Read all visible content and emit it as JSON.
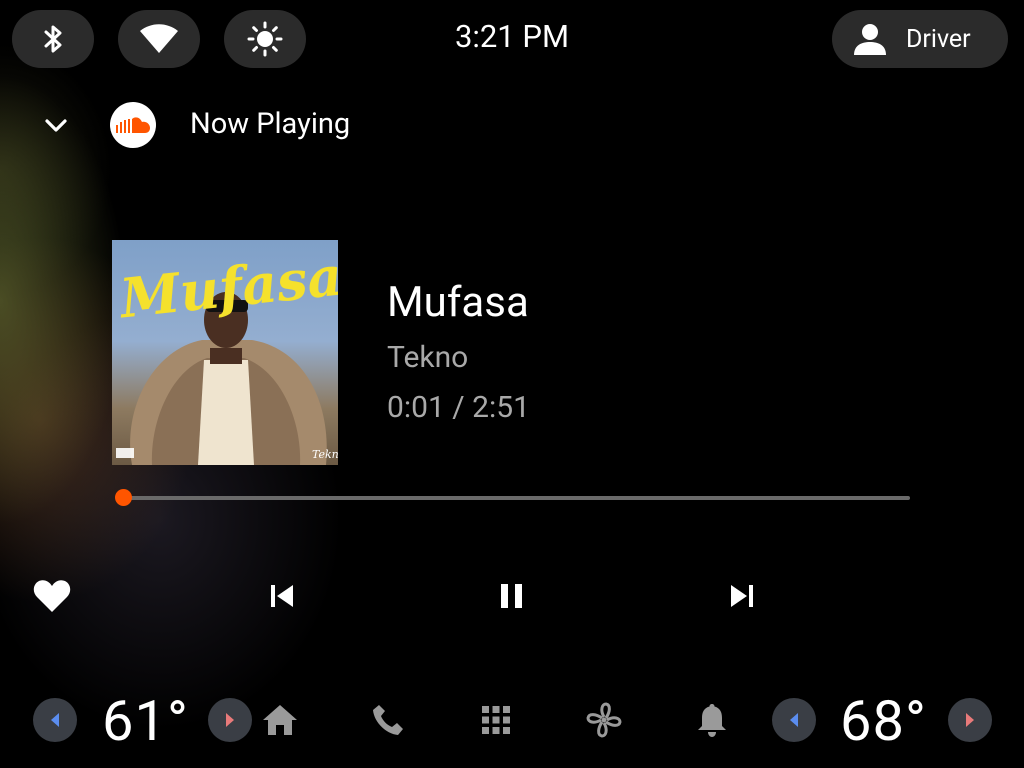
{
  "status_bar": {
    "time": "3:21 PM",
    "user_label": "Driver",
    "icons": [
      "bluetooth-icon",
      "wifi-icon",
      "brightness-icon",
      "person-icon"
    ]
  },
  "now_playing": {
    "header_title": "Now Playing",
    "source_icon": "soundcloud-icon",
    "album_art_text": "Mufasa",
    "album_signature": "Tekno",
    "track_title": "Mufasa",
    "artist": "Tekno",
    "time_display": "0:01 / 2:51",
    "progress_fraction": 0.006
  },
  "controls": {
    "icons": [
      "heart-icon",
      "skip-previous-icon",
      "pause-icon",
      "skip-next-icon"
    ]
  },
  "bottom_bar": {
    "left_temp": "61°",
    "right_temp": "68°",
    "nav_icons": [
      "home-icon",
      "phone-icon",
      "apps-grid-icon",
      "fan-icon",
      "bell-icon"
    ]
  },
  "colors": {
    "accent": "#ff5500",
    "pill_bg": "#2b2b2b",
    "secondary_text": "#a9a9a9",
    "temp_down_arrow": "#5b8def",
    "temp_up_arrow": "#e87a7a"
  }
}
